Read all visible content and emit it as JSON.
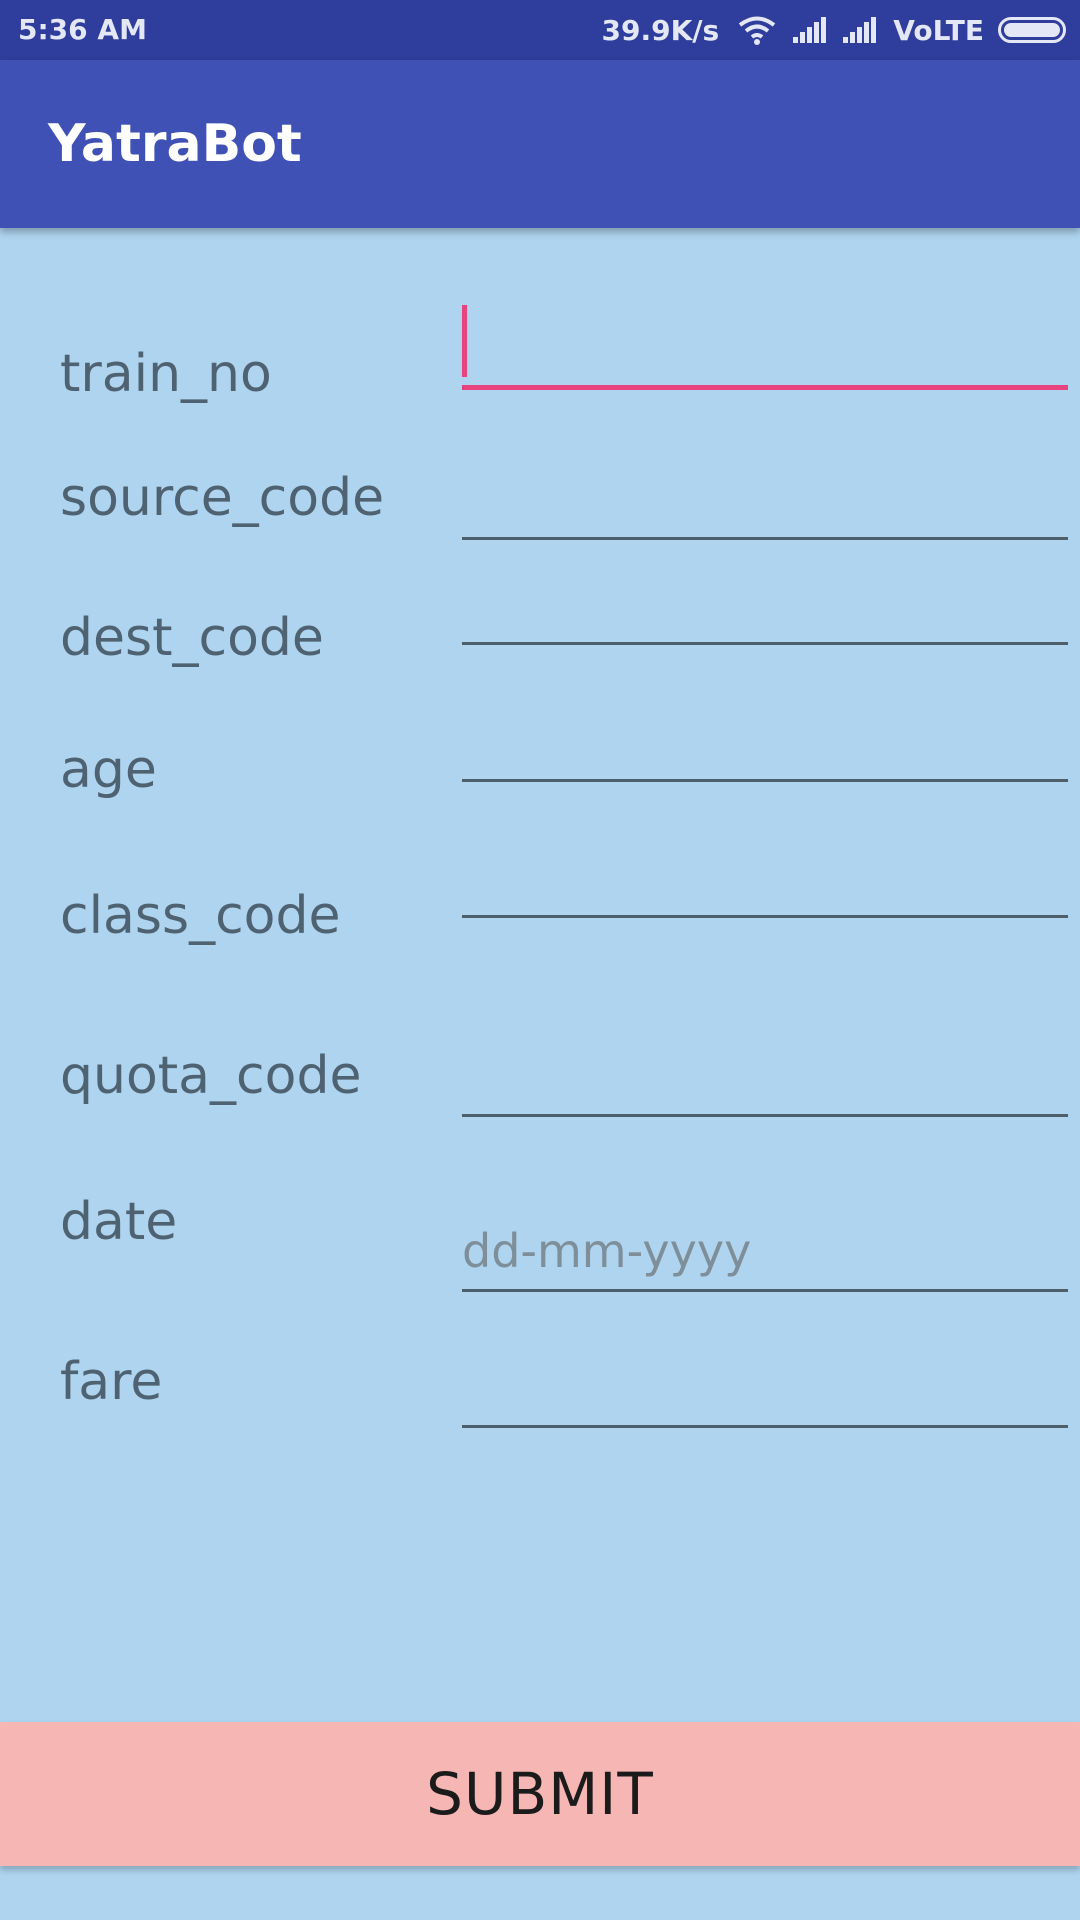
{
  "status_bar": {
    "time": "5:36 AM",
    "speed": "39.9K/s",
    "network": "VoLTE",
    "icons": [
      "wifi-icon",
      "signal-icon",
      "signal-icon",
      "battery-icon"
    ]
  },
  "app_bar": {
    "title": "YatraBot"
  },
  "form": {
    "fields": [
      {
        "label": "train_no",
        "value": "",
        "placeholder": "",
        "focused": true
      },
      {
        "label": "source_code",
        "value": "",
        "placeholder": ""
      },
      {
        "label": "dest_code",
        "value": "",
        "placeholder": ""
      },
      {
        "label": "age",
        "value": "",
        "placeholder": ""
      },
      {
        "label": "class_code",
        "value": "",
        "placeholder": ""
      },
      {
        "label": "quota_code",
        "value": "",
        "placeholder": ""
      },
      {
        "label": "date",
        "value": "",
        "placeholder": "dd-mm-yyyy"
      },
      {
        "label": "fare",
        "value": "",
        "placeholder": ""
      }
    ],
    "submit_label": "SUBMIT"
  },
  "colors": {
    "status_bar": "#2f3d9c",
    "app_bar": "#3f51b5",
    "background": "#aed4ef",
    "accent": "#e8437e",
    "submit_button": "#f5b6b4"
  }
}
